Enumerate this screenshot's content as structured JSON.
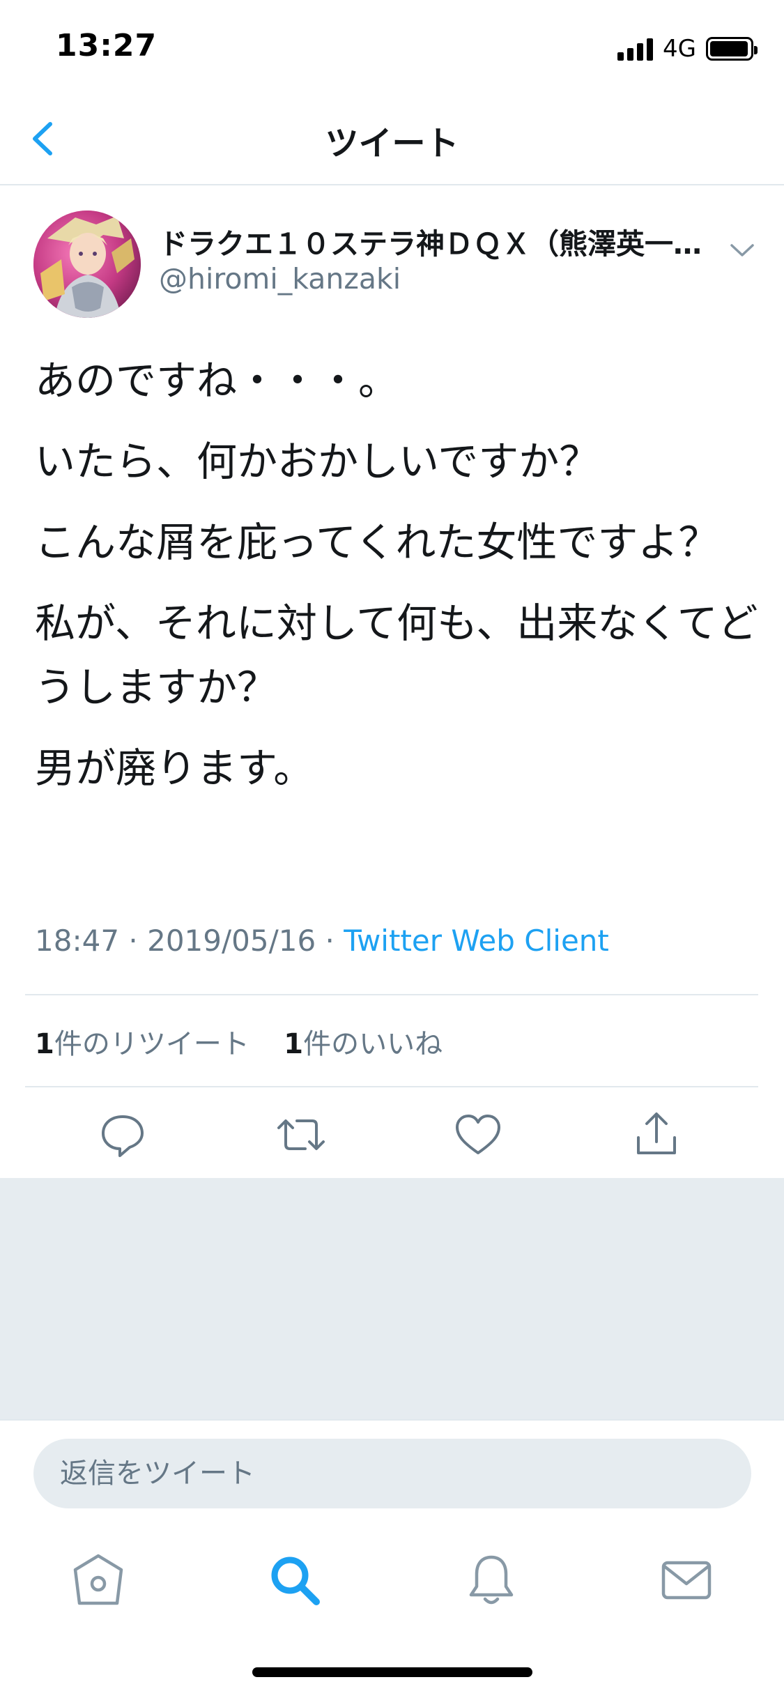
{
  "status_bar": {
    "time": "13:27",
    "network": "4G"
  },
  "nav": {
    "title": "ツイート",
    "back_icon": "chevron-left-icon"
  },
  "tweet": {
    "author": {
      "display_name": "ドラクエ１０ステラ神ＤＱＸ（熊澤英一…",
      "handle": "@hiromi_kanzaki"
    },
    "lines": [
      "あのですね・・・。",
      "いたら、何かおかしいですか？",
      "こんな屑を庇ってくれた女性ですよ？",
      "私が、それに対して何も、出来なくてどうしますか？",
      "男が廃ります。"
    ],
    "time": "18:47",
    "separator": " · ",
    "date": "2019/05/16",
    "source": "Twitter Web Client",
    "retweet_count": "1",
    "retweet_label": "件のリツイート",
    "like_count": "1",
    "like_label": "件のいいね"
  },
  "actions": [
    {
      "icon": "reply-icon"
    },
    {
      "icon": "retweet-icon"
    },
    {
      "icon": "heart-icon"
    },
    {
      "icon": "share-icon"
    }
  ],
  "reply": {
    "placeholder": "返信をツイート"
  },
  "tabs": [
    {
      "icon": "home-icon"
    },
    {
      "icon": "search-icon",
      "active": true
    },
    {
      "icon": "bell-icon"
    },
    {
      "icon": "mail-icon"
    }
  ],
  "colors": {
    "accent": "#1da1f2",
    "secondary_text": "#657786",
    "tab_inactive": "#8899a6",
    "background_grey": "#e6ecf0"
  }
}
